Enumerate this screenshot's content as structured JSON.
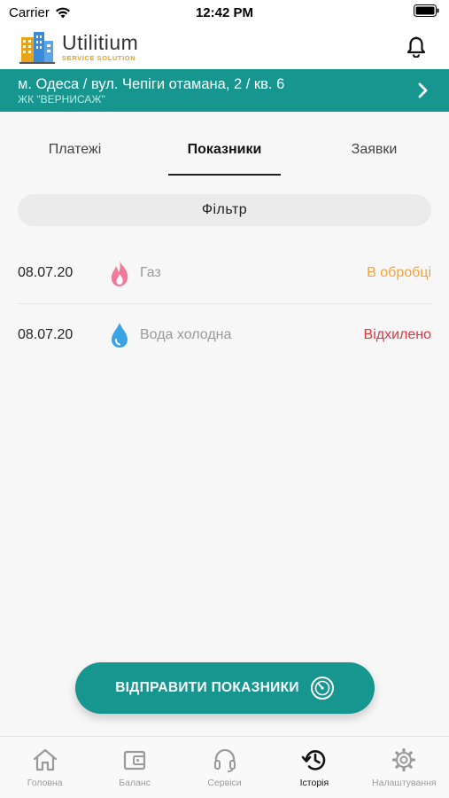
{
  "status_bar": {
    "carrier": "Carrier",
    "time": "12:42 PM"
  },
  "header": {
    "logo_title": "Utilitium",
    "logo_subtitle": "SERVICE SOLUTION"
  },
  "address": {
    "main": "м. Одеса / вул. Чепіги отамана, 2 / кв. 6",
    "sub": "ЖК \"ВЕРНИСАЖ\""
  },
  "tabs": [
    {
      "label": "Платежі",
      "active": false
    },
    {
      "label": "Показники",
      "active": true
    },
    {
      "label": "Заявки",
      "active": false
    }
  ],
  "filter_label": "Фільтр",
  "rows": [
    {
      "date": "08.07.20",
      "icon": "flame-icon",
      "name": "Газ",
      "status": "В обробці",
      "status_color": "#f3a33c"
    },
    {
      "date": "08.07.20",
      "icon": "water-drop-icon",
      "name": "Вода холодна",
      "status": "Відхилено",
      "status_color": "#e0353f"
    }
  ],
  "send_button_label": "ВІДПРАВИТИ ПОКАЗНИКИ",
  "tabbar": [
    {
      "label": "Головна",
      "icon": "home-icon"
    },
    {
      "label": "Баланс",
      "icon": "wallet-icon"
    },
    {
      "label": "Сервіси",
      "icon": "headset-icon"
    },
    {
      "label": "Історія",
      "icon": "history-icon",
      "active": true
    },
    {
      "label": "Налаштування",
      "icon": "gear-icon"
    }
  ],
  "colors": {
    "accent": "#17958f",
    "flame": "#f07a9a",
    "drop": "#3aa3e8"
  }
}
